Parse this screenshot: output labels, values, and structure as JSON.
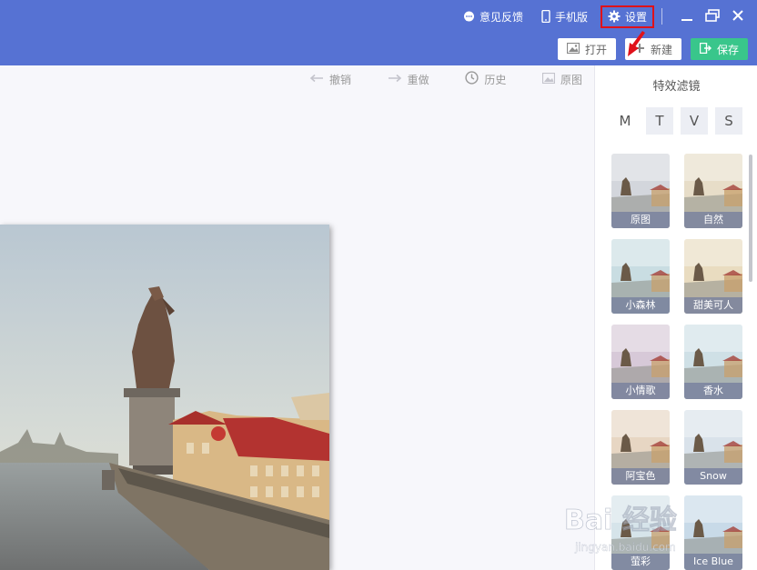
{
  "header": {
    "feedback_label": "意见反馈",
    "mobile_label": "手机版",
    "settings_label": "设置",
    "open_label": "打开",
    "new_label": "新建",
    "save_label": "保存"
  },
  "toolbar": {
    "undo_label": "撤销",
    "redo_label": "重做",
    "history_label": "历史",
    "original_label": "原图"
  },
  "panel": {
    "title": "特效滤镜",
    "tabs": [
      "M",
      "T",
      "V",
      "S"
    ],
    "active_tab": "M",
    "filters": [
      {
        "label": "原图"
      },
      {
        "label": "自然"
      },
      {
        "label": "小森林"
      },
      {
        "label": "甜美可人"
      },
      {
        "label": "小情歌"
      },
      {
        "label": "香水"
      },
      {
        "label": "阿宝色"
      },
      {
        "label": "Snow"
      },
      {
        "label": "萤彩"
      },
      {
        "label": "Ice Blue"
      }
    ]
  },
  "watermark": {
    "text": "Bai 经验",
    "subtext": "jingyan.baidu.com"
  },
  "colors": {
    "header_bg": "#5672d3",
    "save_green": "#39c68b",
    "highlight_red": "#e0111a"
  }
}
